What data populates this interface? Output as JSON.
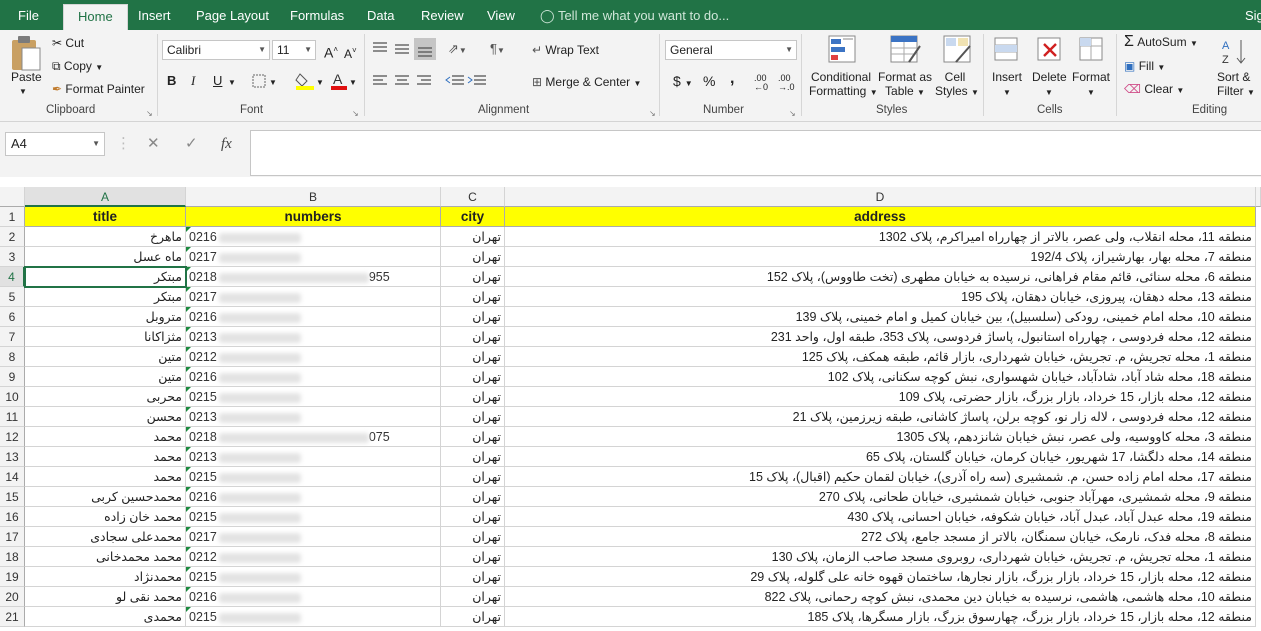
{
  "tabs": [
    "File",
    "Home",
    "Insert",
    "Page Layout",
    "Formulas",
    "Data",
    "Review",
    "View"
  ],
  "tell_me": "Tell me what you want to do...",
  "signin": "Sig",
  "ribbon": {
    "clipboard": {
      "paste": "Paste",
      "cut": "Cut",
      "copy": "Copy",
      "format_painter": "Format Painter",
      "label": "Clipboard"
    },
    "font": {
      "name": "Calibri",
      "size": "11",
      "bold": "B",
      "italic": "I",
      "underline": "U",
      "label": "Font"
    },
    "alignment": {
      "wrap": "Wrap Text",
      "merge": "Merge & Center",
      "label": "Alignment"
    },
    "number": {
      "format": "General",
      "currency": "$",
      "percent": "%",
      "comma": ",",
      "inc": ".00",
      "label": "Number"
    },
    "styles": {
      "cond": "Conditional",
      "cond2": "Formatting",
      "fmt_table": "Format as",
      "fmt_table2": "Table",
      "cell_styles": "Cell",
      "cell_styles2": "Styles",
      "label": "Styles"
    },
    "cells": {
      "insert": "Insert",
      "delete": "Delete",
      "format": "Format",
      "label": "Cells"
    },
    "editing": {
      "autosum": "AutoSum",
      "fill": "Fill",
      "clear": "Clear",
      "sort": "Sort &",
      "sort2": "Filter",
      "label": "Editing"
    }
  },
  "formula_bar": {
    "name_box": "A4",
    "fx": "fx",
    "value": ""
  },
  "columns": [
    "A",
    "B",
    "C",
    "D"
  ],
  "header_row": {
    "title": "title",
    "numbers": "numbers",
    "city": "city",
    "address": "address"
  },
  "rows": [
    {
      "n": "2",
      "title": "ماهرخ",
      "num": "0216",
      "city": "تهران",
      "address": "منطقه 11، محله انقلاب، ولی عصر، بالاتر از چهارراه امیراکرم، پلاک 1302"
    },
    {
      "n": "3",
      "title": "ماه عسل",
      "num": "0217",
      "city": "تهران",
      "address": "منطقه 7، محله بهار، بهارشیراز، پلاک 192/4"
    },
    {
      "n": "4",
      "title": "مبتکر",
      "num": "0218",
      "num_tail": "955",
      "city": "تهران",
      "address": "منطقه 6، محله سنائی، قائم مقام فراهانی، نرسیده به خیابان مطهری (تخت طاووس)، پلاک 152"
    },
    {
      "n": "5",
      "title": "مبتکر",
      "num": "0217",
      "city": "تهران",
      "address": "منطقه 13، محله دهقان، پیروزی، خیابان دهقان، پلاک 195"
    },
    {
      "n": "6",
      "title": "متروبل",
      "num": "0216",
      "city": "تهران",
      "address": "منطقه 10، محله امام خمینی، رودکی (سلسبیل)، بین خیابان کمیل و امام خمینی، پلاک 139"
    },
    {
      "n": "7",
      "title": "مثزاکانا",
      "num": "0213",
      "city": "تهران",
      "address": "منطقه 12، محله فردوسی ، چهارراه استانبول، پاساژ فردوسی، پلاک 353، طبقه اول، واحد 231"
    },
    {
      "n": "8",
      "title": "متین",
      "num": "0212",
      "city": "تهران",
      "address": "منطقه 1، محله تجریش، م. تجریش، خیابان شهرداری، بازار قائم، طبقه همکف، پلاک 125"
    },
    {
      "n": "9",
      "title": "متین",
      "num": "0216",
      "city": "تهران",
      "address": "منطقه 18، محله شاد آباد، شادآباد، خیابان شهسواری، نبش کوچه سکنانی، پلاک 102"
    },
    {
      "n": "10",
      "title": "محربی",
      "num": "0215",
      "city": "تهران",
      "address": "منطقه 12، محله بازار، 15 خرداد، بازار بزرگ، بازار حضرتی، پلاک 109"
    },
    {
      "n": "11",
      "title": "محسن",
      "num": "0213",
      "city": "تهران",
      "address": "منطقه 12، محله فردوسی ، لاله زار نو، کوچه برلن، پاساژ کاشانی، طبقه زیرزمین، پلاک 21"
    },
    {
      "n": "12",
      "title": "محمد",
      "num": "0218",
      "num_tail": "075",
      "city": "تهران",
      "address": "منطقه 3، محله کاووسیه، ولی عصر، نبش خیابان شانزدهم، پلاک 1305"
    },
    {
      "n": "13",
      "title": "محمد",
      "num": "0213",
      "city": "تهران",
      "address": "منطقه 14، محله دلگشا، 17 شهریور، خیابان کرمان، خیابان گلستان، پلاک 65"
    },
    {
      "n": "14",
      "title": "محمد",
      "num": "0215",
      "city": "تهران",
      "address": "منطقه 17، محله امام زاده حسن، م. شمشیری (سه راه آذری)، خیابان لقمان حکیم (اقبال)، پلاک 15"
    },
    {
      "n": "15",
      "title": "محمدحسین کربی",
      "num": "0216",
      "city": "تهران",
      "address": "منطقه 9، محله شمشیری، مهرآباد جنوبی، خیابان شمشیری، خیابان طحانی، پلاک 270"
    },
    {
      "n": "16",
      "title": "محمد خان زاده",
      "num": "0215",
      "city": "تهران",
      "address": "منطقه 19، محله عبدل آباد، عبدل آباد، خیابان شکوفه، خیابان احسانی، پلاک 430"
    },
    {
      "n": "17",
      "title": "محمدعلی سجادی",
      "num": "0217",
      "city": "تهران",
      "address": "منطقه 8، محله فدک، نارمک، خیابان سمنگان، بالاتر از مسجد جامع، پلاک 272"
    },
    {
      "n": "18",
      "title": "محمد محمدخانی",
      "num": "0212",
      "city": "تهران",
      "address": "منطقه 1، محله تجریش، م. تجریش، خیابان شهرداری، روبروی مسجد صاحب الزمان، پلاک 130"
    },
    {
      "n": "19",
      "title": "محمدنژاد",
      "num": "0215",
      "city": "تهران",
      "address": "منطقه 12، محله بازار، 15 خرداد، بازار بزرگ، بازار نجارها، ساختمان قهوه خانه علی گلوله، پلاک 29"
    },
    {
      "n": "20",
      "title": "محمد نقی لو",
      "num": "0216",
      "city": "تهران",
      "address": "منطقه 10، محله هاشمی، هاشمی، نرسیده به خیابان دین محمدی، نبش کوچه رحمانی، پلاک 822"
    },
    {
      "n": "21",
      "title": "محمدی",
      "num": "0215",
      "city": "تهران",
      "address": "منطقه 12، محله بازار، 15 خرداد، بازار بزرگ، چهارسوق بزرگ، بازار مسگرها، پلاک 185"
    }
  ]
}
